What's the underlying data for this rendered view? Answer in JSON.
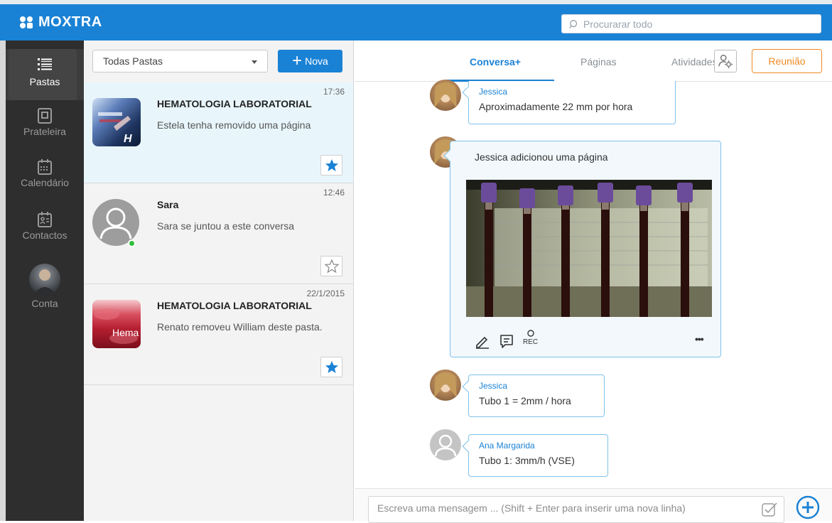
{
  "app": {
    "brand": "MOXTRA"
  },
  "search": {
    "placeholder": "Procurarar todo"
  },
  "nav": {
    "items": [
      {
        "label": "Pastas",
        "icon": "list-icon"
      },
      {
        "label": "Prateleira",
        "icon": "shelf-icon"
      },
      {
        "label": "Calendário",
        "icon": "calendar-icon"
      },
      {
        "label": "Contactos",
        "icon": "contacts-icon"
      },
      {
        "label": "Conta",
        "icon": "account-avatar"
      }
    ]
  },
  "list": {
    "filter": "Todas Pastas",
    "new_label": "Nova",
    "conversations": [
      {
        "time": "17:36",
        "title": "HEMATOLOGIA LABORATORIAL",
        "message": "Estela tenha removido uma página",
        "starred": true
      },
      {
        "time": "12:46",
        "title": "Sara",
        "message": "Sara se juntou a este conversa",
        "starred": false
      },
      {
        "time": "22/1/2015",
        "title": "HEMATOLOGIA LABORATORIAL",
        "message": "Renato removeu William deste pasta.",
        "starred": true,
        "thumb_text": "Hema"
      }
    ]
  },
  "tabs": {
    "conversa": "Conversa+",
    "paginas": "Páginas",
    "atividades": "Atividades",
    "meeting": "Reunião"
  },
  "chat": {
    "m1": {
      "author": "Jessica",
      "text": "Aproximadamente 22 mm por hora"
    },
    "page": {
      "header": "Jessica adicionou uma página",
      "rec": "REC",
      "more": "•••"
    },
    "m2": {
      "author": "Jessica",
      "text": "Tubo 1 = 2mm / hora"
    },
    "m3": {
      "author": "Ana Margarida",
      "text": "Tubo 1: 3mm/h (VSE)"
    }
  },
  "composer": {
    "placeholder": "Escreva uma mensagem ... (Shift + Enter para inserir uma nova linha)"
  },
  "colors": {
    "brand": "#1a82d5",
    "meeting": "#f08a24",
    "online": "#2fbf3a"
  }
}
